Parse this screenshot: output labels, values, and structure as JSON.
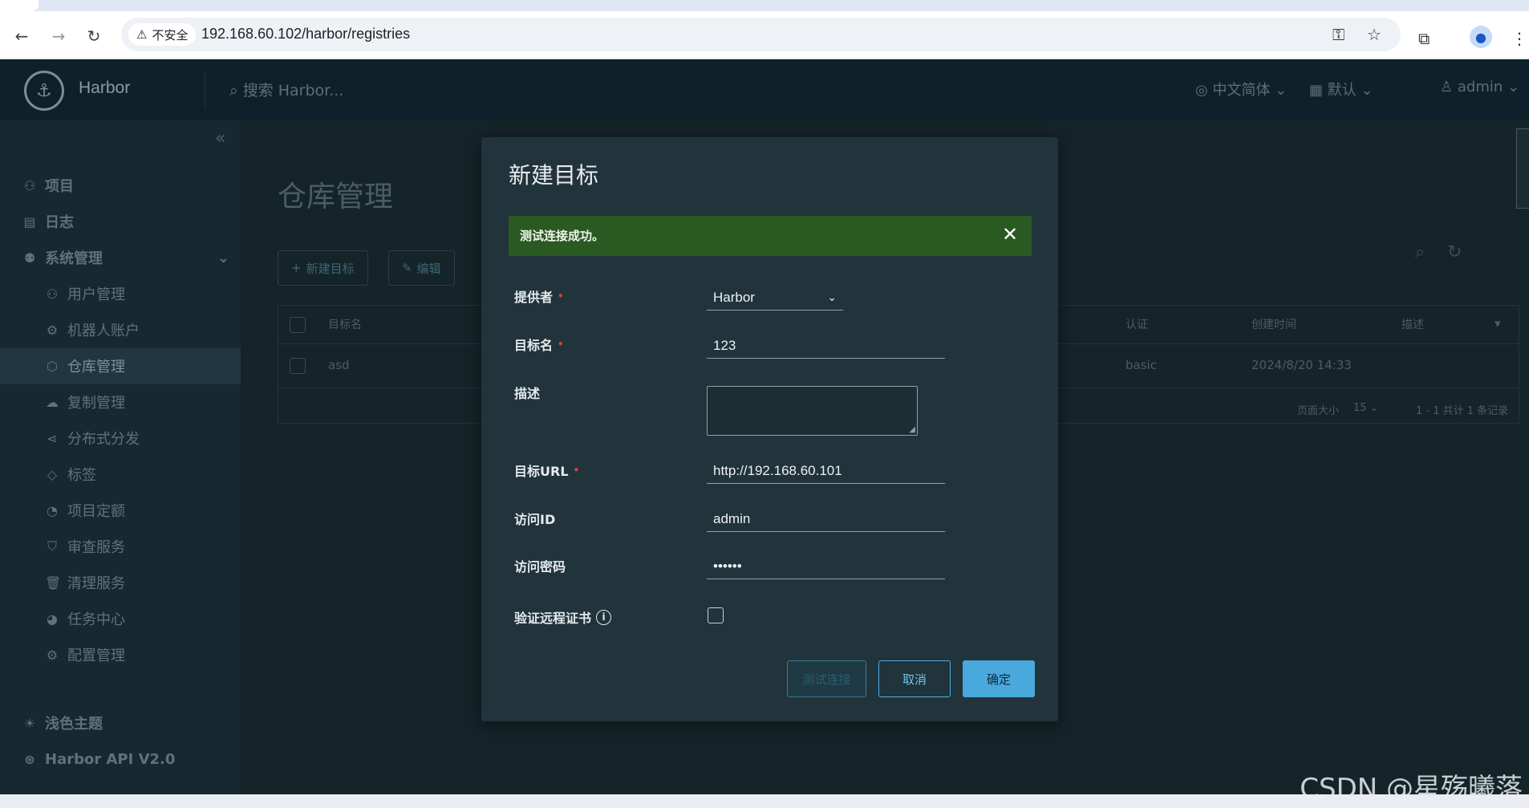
{
  "browser": {
    "security_label": "不安全",
    "url": "192.168.60.102/harbor/registries"
  },
  "header": {
    "brand": "Harbor",
    "search_placeholder": "搜索 Harbor...",
    "language": "中文简体",
    "datetime_format": "默认",
    "user": "admin"
  },
  "sidebar": {
    "items": [
      {
        "label": "项目",
        "icon": "project-icon"
      },
      {
        "label": "日志",
        "icon": "log-icon"
      },
      {
        "label": "系统管理",
        "icon": "admin-icon"
      },
      {
        "label": "用户管理",
        "icon": "users-icon"
      },
      {
        "label": "机器人账户",
        "icon": "robot-icon"
      },
      {
        "label": "仓库管理",
        "icon": "cube-icon"
      },
      {
        "label": "复制管理",
        "icon": "cloud-icon"
      },
      {
        "label": "分布式分发",
        "icon": "share-icon"
      },
      {
        "label": "标签",
        "icon": "tag-icon"
      },
      {
        "label": "项目定额",
        "icon": "quota-icon"
      },
      {
        "label": "审查服务",
        "icon": "shield-icon"
      },
      {
        "label": "清理服务",
        "icon": "trash-icon"
      },
      {
        "label": "任务中心",
        "icon": "dashboard-icon"
      },
      {
        "label": "配置管理",
        "icon": "gear-icon"
      }
    ],
    "theme": "浅色主题",
    "api": "Harbor API V2.0"
  },
  "main": {
    "title": "仓库管理",
    "new_button": "新建目标",
    "edit_button": "编辑",
    "columns": {
      "name": "目标名",
      "auth": "认证",
      "created": "创建时间",
      "desc": "描述"
    },
    "row": {
      "name": "asd",
      "auth": "basic",
      "created": "2024/8/20 14:33"
    },
    "page_size_label": "页面大小",
    "page_size": "15",
    "summary": "1 - 1 共计 1 条记录"
  },
  "modal": {
    "title": "新建目标",
    "alert": "测试连接成功。",
    "labels": {
      "provider": "提供者",
      "name": "目标名",
      "description": "描述",
      "url": "目标URL",
      "access_id": "访问ID",
      "access_secret": "访问密码",
      "verify_cert": "验证远程证书"
    },
    "values": {
      "provider": "Harbor",
      "name": "123",
      "url": "http://192.168.60.101",
      "access_id": "admin",
      "access_secret": "••••••"
    },
    "buttons": {
      "test": "测试连接",
      "cancel": "取消",
      "ok": "确定"
    }
  },
  "watermark": "CSDN @星殇曦落"
}
